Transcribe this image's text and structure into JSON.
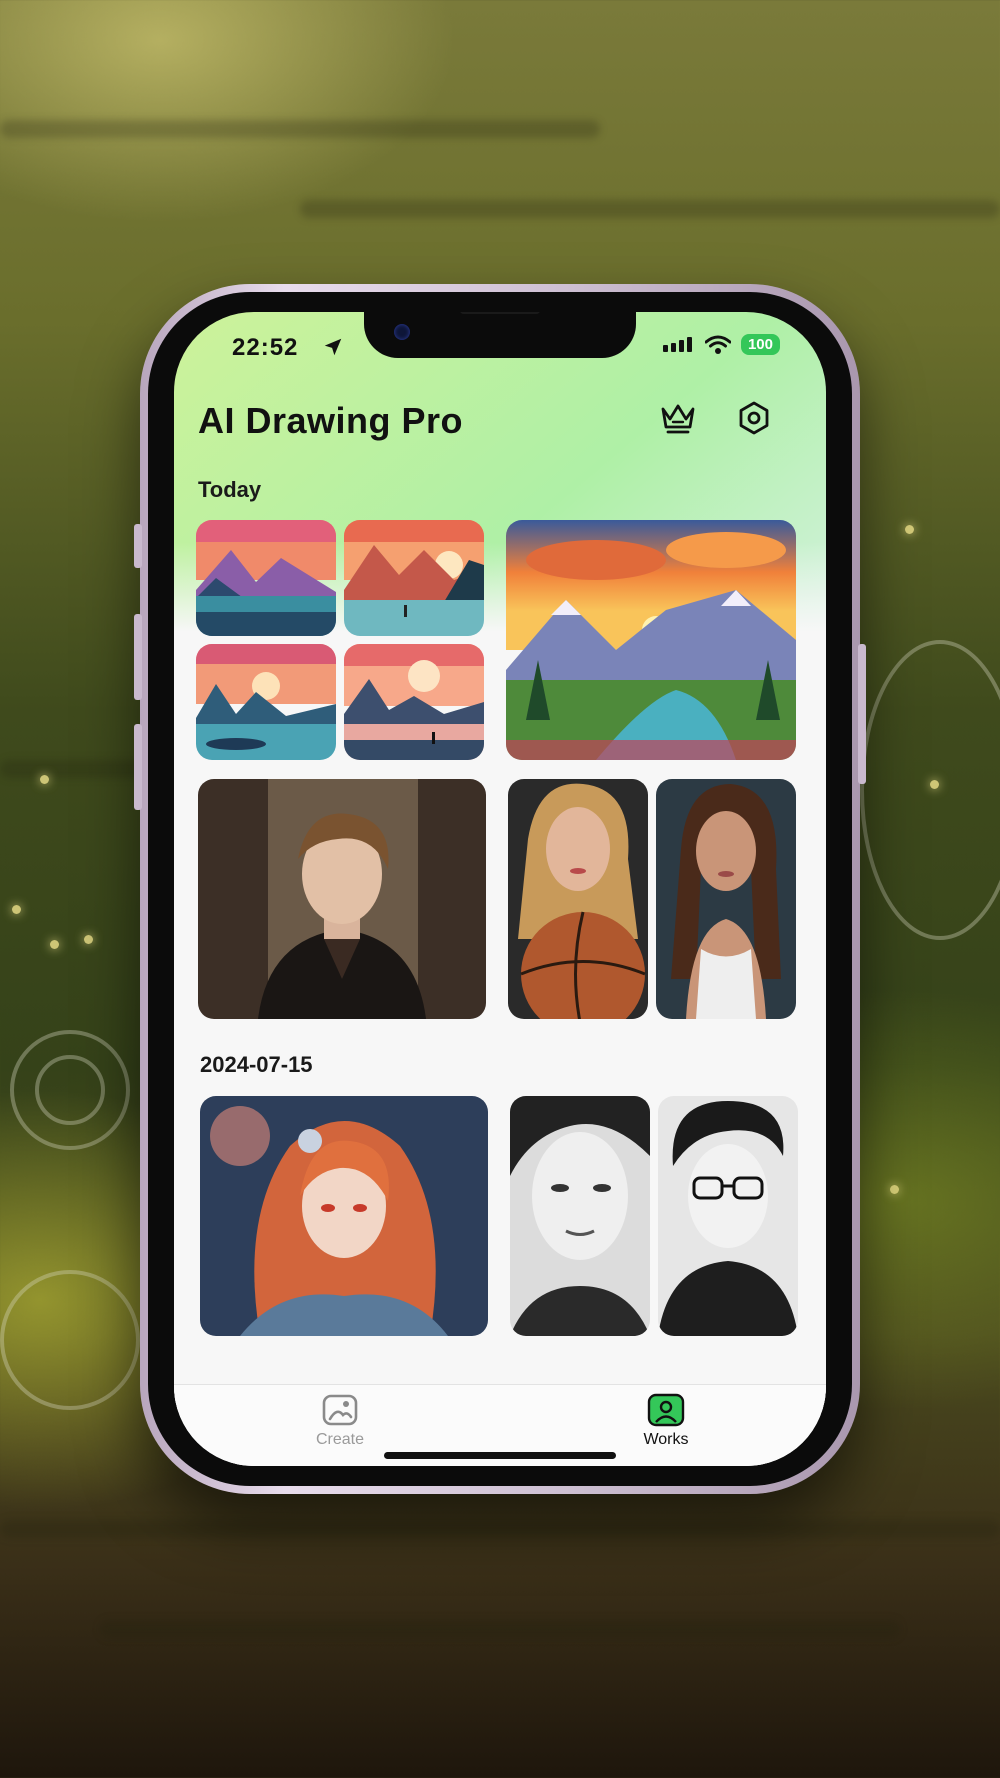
{
  "status_bar": {
    "time": "22:52",
    "battery": "100"
  },
  "header": {
    "title": "AI Drawing Pro",
    "premium_icon": "crown-icon",
    "settings_icon": "hexagon-settings-icon"
  },
  "sections": [
    {
      "label": "Today"
    },
    {
      "label": "2024-07-15"
    }
  ],
  "tab_bar": {
    "create_label": "Create",
    "works_label": "Works",
    "active_tab": "Works",
    "active_color": "#34c759",
    "inactive_color": "#9a9a9a"
  }
}
